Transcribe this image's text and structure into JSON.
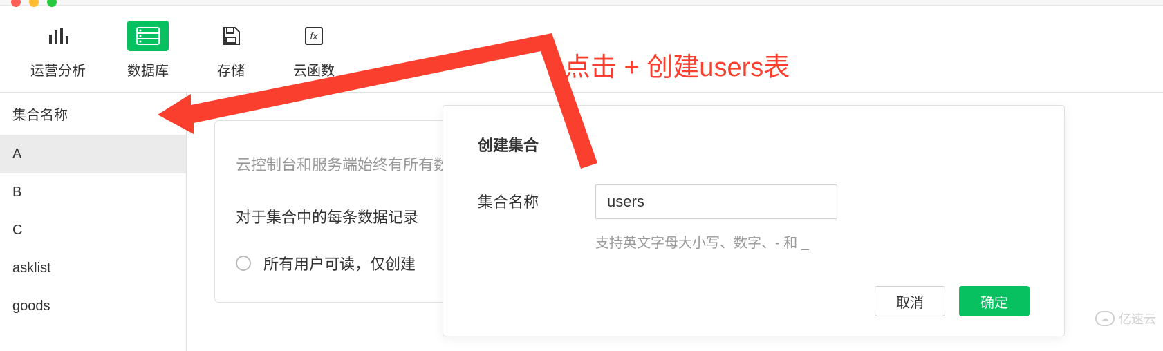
{
  "tabs": [
    {
      "label": "运营分析"
    },
    {
      "label": "数据库"
    },
    {
      "label": "存储"
    },
    {
      "label": "云函数"
    }
  ],
  "sidebar": {
    "title": "集合名称",
    "add": "+",
    "items": [
      {
        "label": "A"
      },
      {
        "label": "B"
      },
      {
        "label": "C"
      },
      {
        "label": "asklist"
      },
      {
        "label": "goods"
      }
    ]
  },
  "content": {
    "line1": "云控制台和服务端始终有所有数据读写权限，以下",
    "line2": "对于集合中的每条数据记录",
    "radio1": "所有用户可读，仅创建"
  },
  "modal": {
    "title": "创建集合",
    "field_label": "集合名称",
    "value": "users",
    "hint": "支持英文字母大小写、数字、- 和 _",
    "cancel": "取消",
    "confirm": "确定"
  },
  "annotation": {
    "text": "点击 + 创建users表"
  },
  "watermark": {
    "text": "亿速云"
  }
}
